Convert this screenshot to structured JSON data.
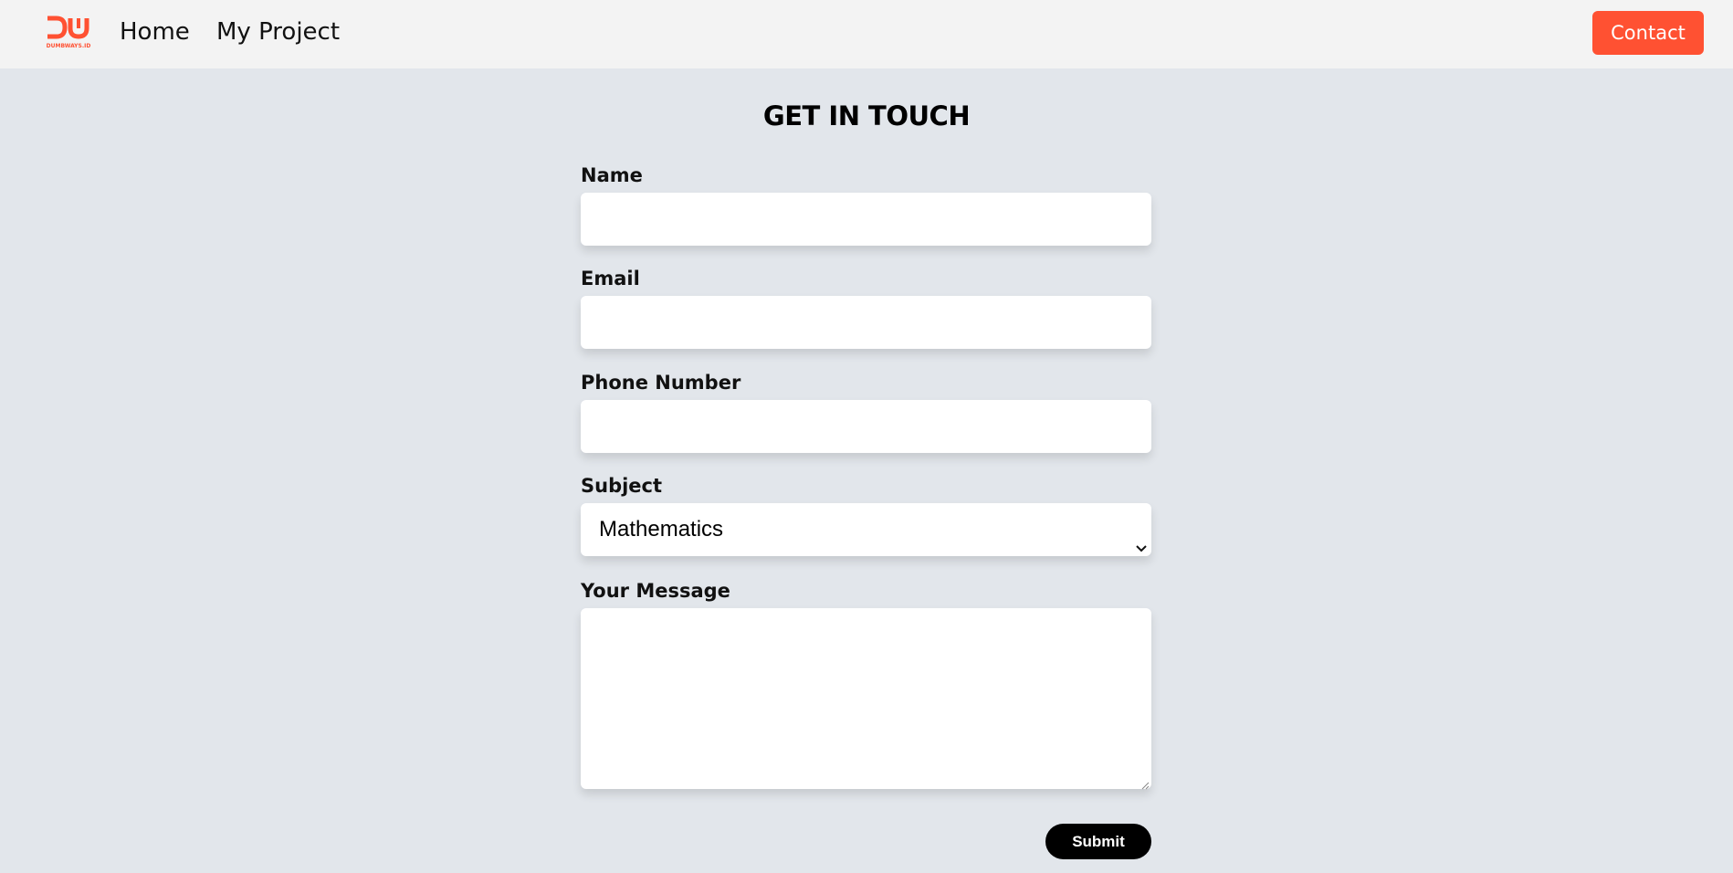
{
  "nav": {
    "logo_text": "DUMBWAYS.ID",
    "home_label": "Home",
    "project_label": "My Project",
    "contact_label": "Contact"
  },
  "form": {
    "title": "GET IN TOUCH",
    "name_label": "Name",
    "name_value": "",
    "email_label": "Email",
    "email_value": "",
    "phone_label": "Phone Number",
    "phone_value": "",
    "subject_label": "Subject",
    "subject_selected": "Mathematics",
    "message_label": "Your Message",
    "message_value": "",
    "submit_label": "Submit"
  },
  "colors": {
    "accent": "#ff5132",
    "page_background": "#e2e6eb",
    "navbar_background": "#f3f3f3",
    "submit_background": "#000000"
  },
  "icons": {
    "select_caret": "chevron-down-icon",
    "textarea_resize": "resize-grip-icon"
  }
}
